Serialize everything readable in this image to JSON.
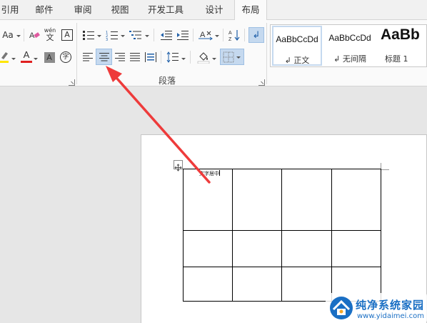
{
  "tabs": [
    {
      "label": "引用"
    },
    {
      "label": "邮件"
    },
    {
      "label": "审阅"
    },
    {
      "label": "视图"
    },
    {
      "label": "开发工具"
    },
    {
      "label": "设计"
    },
    {
      "label": "布局"
    }
  ],
  "ribbon": {
    "font_group": {
      "font_size_label": "Aa",
      "phonetic_top": "wén",
      "phonetic_char": "文",
      "boxed_char": "A",
      "font_color_char": "A",
      "shade_char": "A",
      "enclose_char": "字"
    },
    "paragraph_group": {
      "label": "段落",
      "align_center_selected": true
    },
    "styles": [
      {
        "sample": "AaBbCcDd",
        "name": "↲ 正文",
        "selected": true
      },
      {
        "sample": "AaBbCcDd",
        "name": "↲ 无间隔",
        "selected": false
      },
      {
        "sample": "AaBb",
        "name": "标题 1",
        "selected": false
      }
    ]
  },
  "document": {
    "first_cell_text": "文字居中"
  },
  "watermark": {
    "title": "纯净系统家园",
    "url": "www.yidaimei.com"
  },
  "colors": {
    "highlight": "#ffe600",
    "font_color_bar": "#e02020",
    "arrow": "#ee3b3b",
    "accent": "#1a6fc4"
  }
}
